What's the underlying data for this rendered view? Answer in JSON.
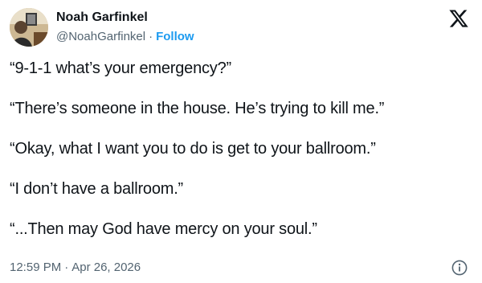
{
  "author": {
    "display_name": "Noah Garfinkel",
    "handle": "@NoahGarfinkel",
    "separator": "·",
    "follow_label": "Follow"
  },
  "icons": {
    "brand": "x-logo-icon",
    "info": "info-icon",
    "accent_color": "#1d9bf0",
    "muted_color": "#536471"
  },
  "tweet": {
    "lines": [
      "“9-1-1 what’s your emergency?”",
      "“There’s someone in the house. He’s trying to kill me.”",
      "“Okay, what I want you to do is get to your ballroom.”",
      "“I don’t have a ballroom.”",
      "“...Then may God have mercy on your soul.”"
    ]
  },
  "meta": {
    "time": "12:59 PM",
    "separator": "·",
    "date": "Apr 26, 2026"
  }
}
